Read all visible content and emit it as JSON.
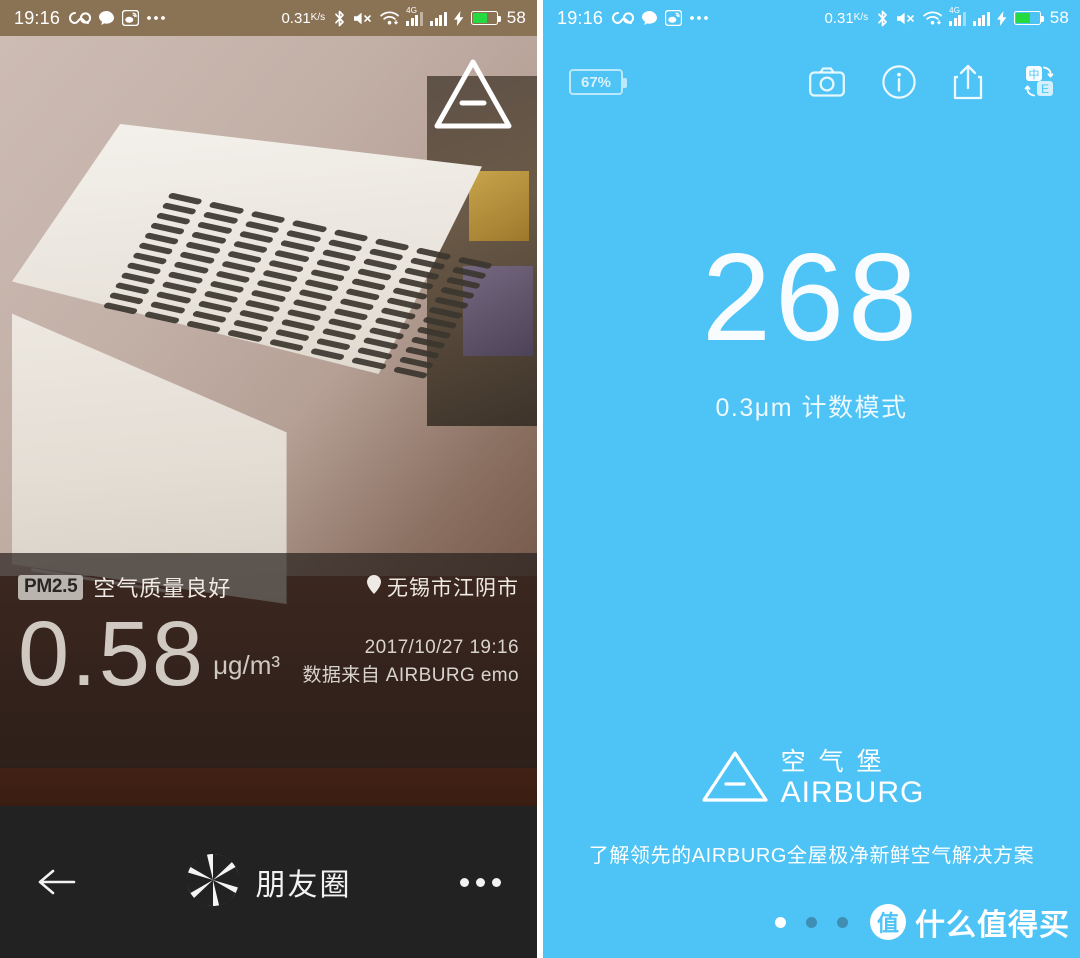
{
  "status_bar": {
    "time": "19:16",
    "icons": [
      "infinity-icon",
      "chat-bubble-icon",
      "weibo-icon",
      "more-dots-icon"
    ],
    "network_speed": "0.31",
    "network_speed_unit": "K/s",
    "right_icons": [
      "bluetooth-icon",
      "mute-icon",
      "wifi-icon",
      "4g-signal-icon",
      "signal-icon",
      "charging-bolt-icon"
    ],
    "lte_label": "4G",
    "battery_percent": "58"
  },
  "left_panel": {
    "logo_name": "airburg-triangle-logo",
    "info": {
      "pm_badge": "PM2.5",
      "quality_text": "空气质量良好",
      "location": "无锡市江阴市",
      "value": "0.58",
      "unit": "μg/m³",
      "timestamp": "2017/10/27 19:16",
      "source": "数据来自 AIRBURG emo"
    },
    "bottom_bar": {
      "back_label": "back-arrow",
      "share_target": "朋友圈",
      "more_label": "more-options"
    }
  },
  "right_panel": {
    "accent_color": "#4ec3f5",
    "battery": "67%",
    "toolbar_icons": [
      "camera-icon",
      "info-icon",
      "share-icon",
      "language-toggle-icon"
    ],
    "reading": {
      "value": "268",
      "mode": "0.3μm 计数模式"
    },
    "brand": {
      "cn": "空气堡",
      "en": "AIRBURG",
      "tagline": "了解领先的AIRBURG全屋极净新鲜空气解决方案"
    },
    "pagination": {
      "total": 3,
      "active": 1
    },
    "watermark": {
      "badge": "值",
      "text": "什么值得买"
    }
  }
}
